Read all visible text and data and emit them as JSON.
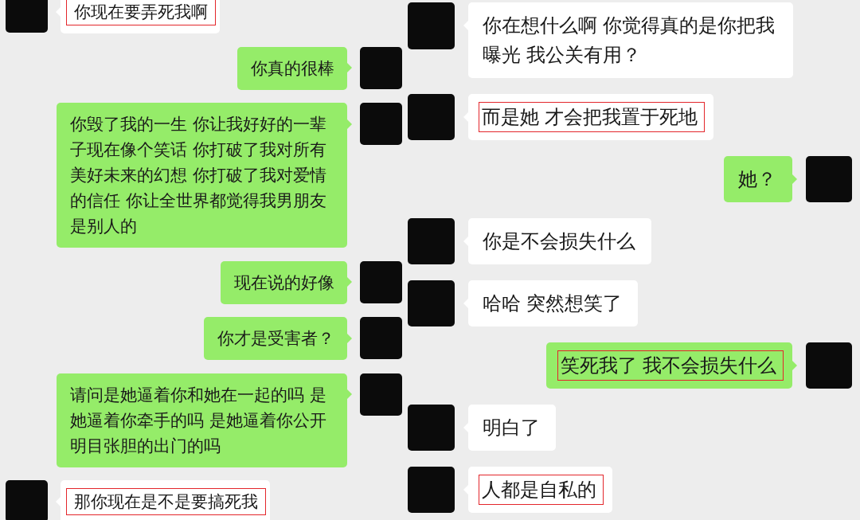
{
  "panels": [
    {
      "messages": [
        {
          "kind": "received",
          "text": "你现在要弄死我啊",
          "highlighted": true
        },
        {
          "kind": "sent",
          "text": "你真的很棒",
          "highlighted": false
        },
        {
          "kind": "sent",
          "text": "你毁了我的一生 你让我好好的一辈子现在像个笑话 你打破了我对所有美好未来的幻想 你打破了我对爱情的信任 你让全世界都觉得我男朋友是别人的",
          "highlighted": false
        },
        {
          "kind": "sent",
          "text": "现在说的好像",
          "highlighted": false
        },
        {
          "kind": "sent",
          "text": "你才是受害者？",
          "highlighted": false
        },
        {
          "kind": "sent",
          "text": "请问是她逼着你和她在一起的吗 是她逼着你牵手的吗 是她逼着你公开明目张胆的出门的吗",
          "highlighted": false
        },
        {
          "kind": "received",
          "text": "那你现在是不是要搞死我",
          "highlighted": true
        }
      ]
    },
    {
      "messages": [
        {
          "kind": "received",
          "text": "你在想什么啊 你觉得真的是你把我曝光 我公关有用？",
          "highlighted": false
        },
        {
          "kind": "received",
          "text": "而是她 才会把我置于死地",
          "highlighted": true
        },
        {
          "kind": "sent",
          "text": "她？",
          "highlighted": false
        },
        {
          "kind": "received",
          "text": "你是不会损失什么",
          "highlighted": false
        },
        {
          "kind": "received",
          "text": "哈哈 突然想笑了",
          "highlighted": false
        },
        {
          "kind": "sent",
          "text": "笑死我了 我不会损失什么",
          "highlighted": true
        },
        {
          "kind": "received",
          "text": "明白了",
          "highlighted": false
        },
        {
          "kind": "received",
          "text": "人都是自私的",
          "highlighted": true
        }
      ]
    }
  ]
}
